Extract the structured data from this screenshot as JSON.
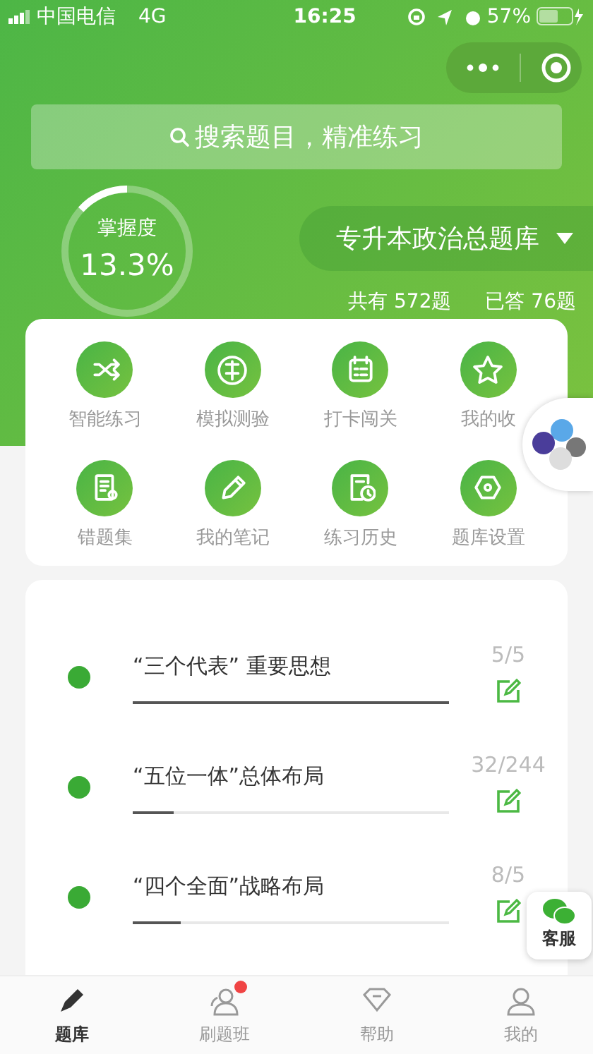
{
  "status_bar": {
    "carrier": "中国电信",
    "network": "4G",
    "time": "16:25",
    "battery": "57%"
  },
  "search": {
    "placeholder": "搜索题目，精准练习"
  },
  "mastery": {
    "label": "掌握度",
    "value": "13.3%",
    "level": 0.133
  },
  "bank": {
    "name": "专升本政治总题库",
    "total": "共有 572题",
    "answered": "已答 76题"
  },
  "tools": [
    {
      "label": "智能练习"
    },
    {
      "label": "模拟测验"
    },
    {
      "label": "打卡闯关"
    },
    {
      "label": "我的收"
    },
    {
      "label": "错题集"
    },
    {
      "label": "我的笔记"
    },
    {
      "label": "练习历史"
    },
    {
      "label": "题库设置"
    }
  ],
  "chapters": [
    {
      "title": "“三个代表” 重要思想",
      "count": "5/5",
      "level": 1.0
    },
    {
      "title": "“五位一体”总体布局",
      "count": "32/244",
      "level": 0.13
    },
    {
      "title": "“四个全面”战略布局",
      "count": "8/5",
      "level": 0.15
    }
  ],
  "service_button": {
    "label": "客服"
  },
  "tab_bar": [
    {
      "label": "题库",
      "selected": true,
      "badge": false
    },
    {
      "label": "刷题班",
      "selected": false,
      "badge": true
    },
    {
      "label": "帮助",
      "selected": false,
      "badge": false
    },
    {
      "label": "我的",
      "selected": false,
      "badge": false
    }
  ]
}
